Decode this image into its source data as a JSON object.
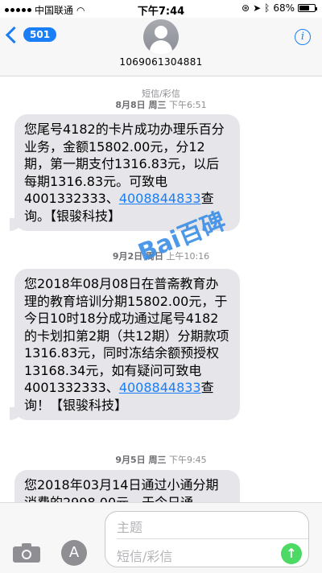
{
  "status_bar": {
    "carrier": "中国联通",
    "time": "下午7:44",
    "battery": "68%",
    "battery_level": 0.68
  },
  "header": {
    "back_count": "501",
    "contact_number": "1069061304881"
  },
  "conversation": {
    "service_label": "短信/彩信",
    "messages": [
      {
        "date": "8月8日 周三",
        "time": "下午6:51",
        "text_before_link": "您尾号4182的卡片成功办理乐百分业务，金额15802.00元，分12期，第一期支付1316.83元，以后每期1316.83元。可致电4001332333、",
        "link": "4008844833",
        "text_after_link": "查询。【银骏科技】"
      },
      {
        "date": "9月2日 周日",
        "time": "上午10:16",
        "text_before_link": "您2018年08月08日在普斋教育办理的教育培训分期15802.00元，于今日10时18分成功通过尾号4182的卡划扣第2期（共12期）分期款项1316.83元，同时冻结余额预授权13168.34元，如有疑问可致电4001332333、",
        "link": "4008844833",
        "text_after_link": "查询！【银骏科技】"
      },
      {
        "date": "9月5日 周三",
        "time": "下午9:45",
        "text_before_link": "您2018年03月14日通过小通分期消费的2998.00元，于今日通",
        "link": "",
        "text_after_link": ""
      }
    ]
  },
  "watermark": "Bai百碑",
  "input_bar": {
    "subject_placeholder": "主题",
    "message_placeholder": "短信/彩信"
  },
  "colors": {
    "accent": "#1a7ef6",
    "bubble": "#e5e5ea",
    "send": "#4cd964"
  }
}
